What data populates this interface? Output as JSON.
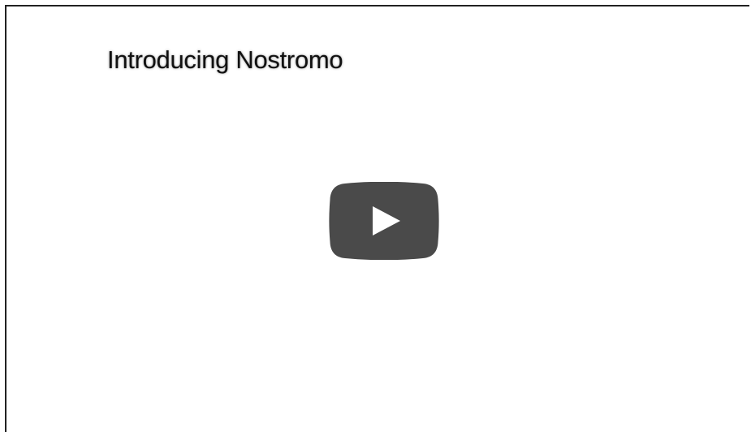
{
  "video": {
    "title": "Introducing Nostromo",
    "play_button_icon": "play-icon",
    "play_button_color": "#4a4a4a",
    "play_triangle_color": "#ffffff"
  }
}
